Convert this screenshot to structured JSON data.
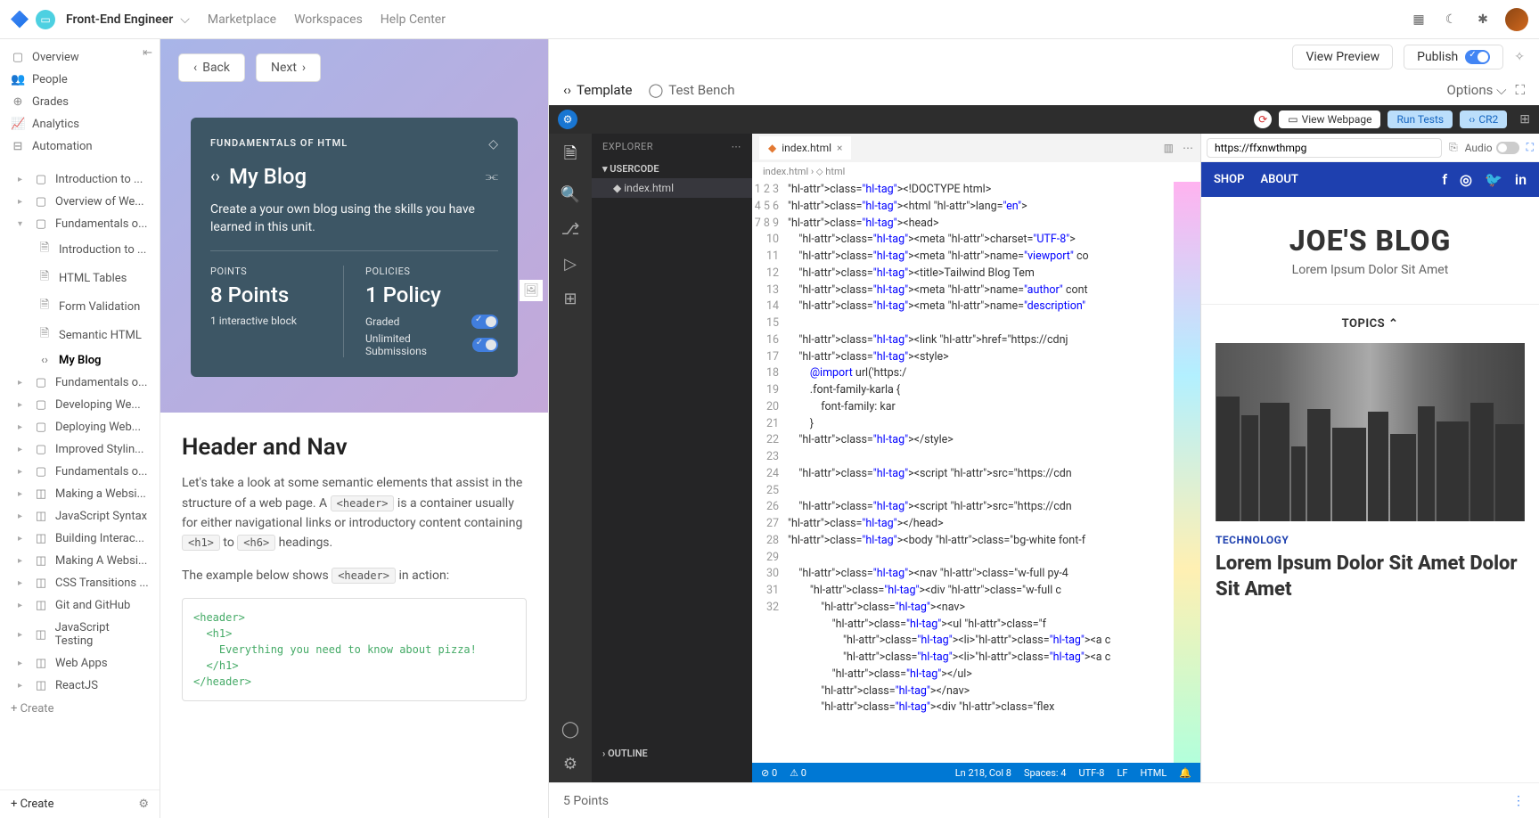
{
  "top": {
    "courseTitle": "Front-End Engineer",
    "nav": [
      "Marketplace",
      "Workspaces",
      "Help Center"
    ]
  },
  "sidebar": {
    "main": [
      {
        "icon": "▢",
        "label": "Overview"
      },
      {
        "icon": "👥",
        "label": "People"
      },
      {
        "icon": "⊕",
        "label": "Grades"
      },
      {
        "icon": "📈",
        "label": "Analytics"
      },
      {
        "icon": "⊟",
        "label": "Automation"
      }
    ],
    "tree": [
      {
        "label": "Introduction to ...",
        "type": "folder"
      },
      {
        "label": "Overview of We...",
        "type": "folder"
      },
      {
        "label": "Fundamentals o...",
        "type": "folder",
        "expanded": true,
        "children": [
          {
            "label": "Introduction to ...",
            "type": "doc"
          },
          {
            "label": "HTML Tables",
            "type": "doc"
          },
          {
            "label": "Form Validation",
            "type": "doc"
          },
          {
            "label": "Semantic HTML",
            "type": "doc"
          },
          {
            "label": "My Blog",
            "type": "code",
            "active": true
          }
        ]
      },
      {
        "label": "Fundamentals o...",
        "type": "folder"
      },
      {
        "label": "Developing We...",
        "type": "folder"
      },
      {
        "label": "Deploying Web...",
        "type": "folder"
      },
      {
        "label": "Improved Stylin...",
        "type": "folder"
      },
      {
        "label": "Fundamentals o...",
        "type": "folder"
      },
      {
        "label": "Making a Websi...",
        "type": "stack"
      },
      {
        "label": "JavaScript Syntax",
        "type": "stack"
      },
      {
        "label": "Building Interac...",
        "type": "stack"
      },
      {
        "label": "Making A Websi...",
        "type": "stack"
      },
      {
        "label": "CSS Transitions ...",
        "type": "stack"
      },
      {
        "label": "Git and GitHub",
        "type": "stack"
      },
      {
        "label": "JavaScript Testing",
        "type": "stack"
      },
      {
        "label": "Web Apps",
        "type": "stack"
      },
      {
        "label": "ReactJS",
        "type": "stack"
      }
    ],
    "create": "+ Create",
    "bottomCreate": "+ Create"
  },
  "hero": {
    "back": "Back",
    "next": "Next",
    "label": "FUNDAMENTALS OF HTML",
    "title": "My Blog",
    "desc": "Create a your own blog using the skills you have learned in this unit.",
    "pointsLabel": "POINTS",
    "points": "8 Points",
    "pointsSub": "1 interactive block",
    "policiesLabel": "POLICIES",
    "policies": "1 Policy",
    "graded": "Graded",
    "unlimited": "Unlimited Submissions"
  },
  "lesson": {
    "h2": "Header and Nav",
    "p1a": "Let's take a look at some semantic elements that assist in the structure of a web page. A ",
    "p1b": " is a container usually for either navigational links or introductory content containing ",
    "p1c": " to ",
    "p1d": " headings.",
    "p2a": "The example below shows ",
    "p2b": " in action:",
    "code": "<header>\n  <h1>\n    Everything you need to know about pizza!\n  </h1>\n</header>",
    "tags": {
      "header": "<header>",
      "h1": "<h1>",
      "h6": "<h6>"
    }
  },
  "ide": {
    "viewPreview": "View Preview",
    "publish": "Publish",
    "tabs": {
      "template": "Template",
      "testBench": "Test Bench"
    },
    "options": "Options",
    "viewWebpage": "View Webpage",
    "runTests": "Run Tests",
    "cr2": "CR2",
    "explorer": "EXPLORER",
    "usercode": "USERCODE",
    "file": "index.html",
    "outline": "OUTLINE",
    "tab": "index.html",
    "breadcrumb": "index.html › ⬦ html",
    "url": "https://ffxnwthmpg",
    "audio": "Audio",
    "status": {
      "errors": "⊘ 0",
      "warnings": "⚠ 0",
      "pos": "Ln 218, Col 8",
      "spaces": "Spaces: 4",
      "enc": "UTF-8",
      "eol": "LF",
      "lang": "HTML"
    }
  },
  "blog": {
    "nav": [
      "SHOP",
      "ABOUT"
    ],
    "title": "JOE'S BLOG",
    "subtitle": "Lorem Ipsum Dolor Sit Amet",
    "topics": "TOPICS",
    "category": "TECHNOLOGY",
    "articleTitle": "Lorem Ipsum Dolor Sit Amet Dolor Sit Amet"
  },
  "footer": {
    "points": "5 Points"
  }
}
